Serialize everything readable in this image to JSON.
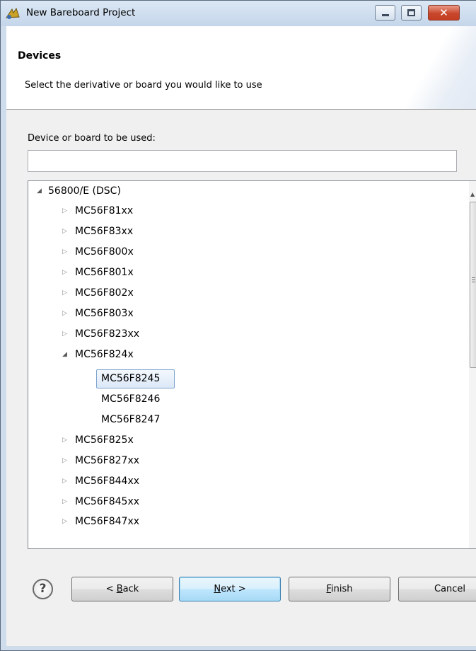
{
  "window": {
    "title": "New Bareboard Project"
  },
  "header": {
    "title": "Devices",
    "description": "Select the derivative or board you would like to use"
  },
  "filter": {
    "label": "Device or board to be used:",
    "value": "",
    "placeholder": ""
  },
  "tree": {
    "root": "56800/E (DSC)",
    "families": [
      "MC56F81xx",
      "MC56F83xx",
      "MC56F800x",
      "MC56F801x",
      "MC56F802x",
      "MC56F803x",
      "MC56F823xx"
    ],
    "expanded_family": "MC56F824x",
    "children": [
      "MC56F8245",
      "MC56F8246",
      "MC56F8247"
    ],
    "selected": "MC56F8245",
    "families_after": [
      "MC56F825x",
      "MC56F827xx",
      "MC56F844xx",
      "MC56F845xx",
      "MC56F847xx"
    ]
  },
  "buttons": {
    "help": "?",
    "back_pre": "< ",
    "back_key": "B",
    "back_post": "ack",
    "next_key": "N",
    "next_post": "ext >",
    "finish_key": "F",
    "finish_post": "inish",
    "cancel": "Cancel"
  },
  "icons": {
    "title": "project-wizard-icon",
    "expanded": "triangle-expanded-icon",
    "collapsed": "triangle-collapsed-icon"
  },
  "colors": {
    "title_bar": "#cfdcec",
    "selection_border": "#7da2ce",
    "close_button": "#c8462c"
  }
}
